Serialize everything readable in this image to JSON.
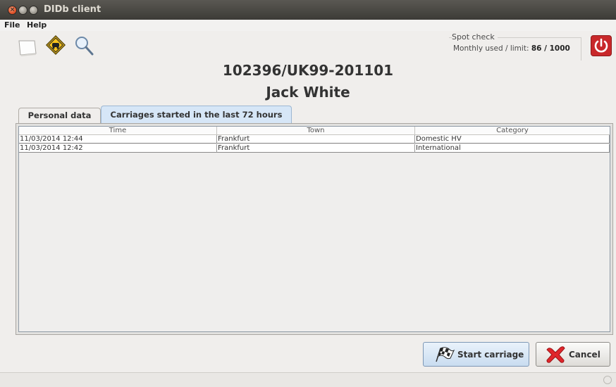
{
  "window": {
    "title": "DIDb client"
  },
  "menu": [
    "File",
    "Help"
  ],
  "toolbar": {
    "buttons": [
      "new-document-icon",
      "road-sign-icon",
      "search-icon"
    ]
  },
  "spot_check": {
    "legend": "Spot check",
    "label": "Monthly used / limit:",
    "value": "86 / 1000"
  },
  "power_icon": "power-icon",
  "header": {
    "id": "102396/UK99-201101",
    "name": "Jack White"
  },
  "tabs": [
    {
      "label": "Personal data",
      "active": false
    },
    {
      "label": "Carriages started in the last 72 hours",
      "active": true
    }
  ],
  "table": {
    "columns": [
      "Time",
      "Town",
      "Category"
    ],
    "rows": [
      [
        "11/03/2014 12:44",
        "Frankfurt",
        "Domestic HV"
      ],
      [
        "11/03/2014 12:42",
        "Frankfurt",
        "International"
      ]
    ]
  },
  "buttons": {
    "start": "Start carriage",
    "cancel": "Cancel"
  },
  "colors": {
    "active_tab": "#d6e6f7",
    "power": "#c8282a",
    "cancel_x": "#e0262b"
  }
}
